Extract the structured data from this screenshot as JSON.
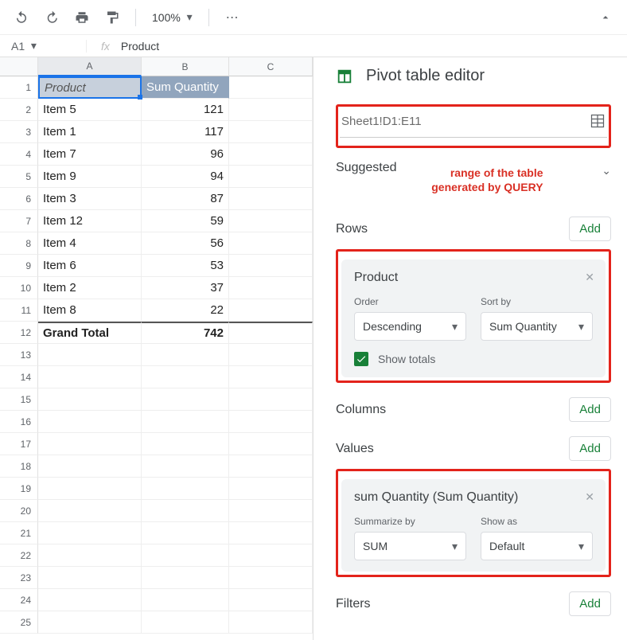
{
  "toolbar": {
    "zoom": "100%"
  },
  "formula_bar": {
    "cell_ref": "A1",
    "fx_label": "fx",
    "value": "Product"
  },
  "columns": [
    "A",
    "B",
    "C"
  ],
  "row_count": 25,
  "chart_data": {
    "type": "table",
    "headers": [
      "Product",
      "Sum Quantity"
    ],
    "rows": [
      {
        "product": "Item 5",
        "sum": 121
      },
      {
        "product": "Item 1",
        "sum": 117
      },
      {
        "product": "Item 7",
        "sum": 96
      },
      {
        "product": "Item 9",
        "sum": 94
      },
      {
        "product": "Item 3",
        "sum": 87
      },
      {
        "product": "Item 12",
        "sum": 59
      },
      {
        "product": "Item 4",
        "sum": 56
      },
      {
        "product": "Item 6",
        "sum": 53
      },
      {
        "product": "Item 2",
        "sum": 37
      },
      {
        "product": "Item 8",
        "sum": 22
      }
    ],
    "grand_total": {
      "label": "Grand Total",
      "value": 742
    }
  },
  "panel": {
    "title": "Pivot table editor",
    "range": "Sheet1!D1:E11",
    "annotation": "range of the table\ngenerated by QUERY",
    "suggested_label": "Suggested",
    "rows_label": "Rows",
    "columns_label": "Columns",
    "values_label": "Values",
    "filters_label": "Filters",
    "add_label": "Add",
    "rows_card": {
      "title": "Product",
      "order_label": "Order",
      "order_value": "Descending",
      "sortby_label": "Sort by",
      "sortby_value": "Sum Quantity",
      "show_totals": "Show totals"
    },
    "values_card": {
      "title": "sum Quantity (Sum Quantity)",
      "summarize_label": "Summarize by",
      "summarize_value": "SUM",
      "showas_label": "Show as",
      "showas_value": "Default"
    }
  }
}
